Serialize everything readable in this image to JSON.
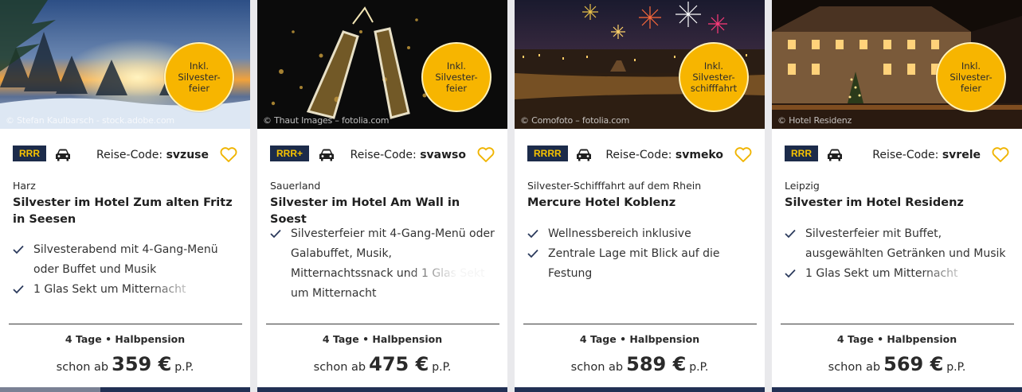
{
  "colors": {
    "navy": "#1c2b4a",
    "gold": "#f7b500",
    "heart": "#f0b400",
    "check": "#2b3a5c"
  },
  "cards": [
    {
      "credit": "© Stefan Kaulbarsch - stock.adobe.com",
      "badge": "Inkl.\nSilvester-\nfeier",
      "rating": "RRR",
      "code_label": "Reise-Code:",
      "code": "svzuse",
      "region": "Harz",
      "hotel": "Silvester im Hotel Zum alten Fritz in Seesen",
      "features": [
        "Silvesterabend mit 4-Gang-Menü oder Buffet und Musik",
        "1 Glas Sekt um Mitternacht"
      ],
      "duration": "4 Tage • Halbpension",
      "price_prefix": "schon ab",
      "price": "359 €",
      "price_suffix": "p.P.",
      "progress": 0.4
    },
    {
      "credit": "© Thaut Images – fotolia.com",
      "badge": "Inkl.\nSilvester-\nfeier",
      "rating": "RRR+",
      "code_label": "Reise-Code:",
      "code": "svawso",
      "region": "Sauerland",
      "hotel": "Silvester im Hotel Am Wall in Soest",
      "features": [
        "Silvesterfeier mit 4-Gang-Menü oder Galabuffet, Musik, Mitternachtssnack und 1 Glas Sekt um Mitternacht"
      ],
      "duration": "4 Tage • Halbpension",
      "price_prefix": "schon ab",
      "price": "475 €",
      "price_suffix": "p.P.",
      "progress": 0
    },
    {
      "credit": "© Comofoto – fotolia.com",
      "badge": "Inkl.\nSilvester-\nschifffahrt",
      "rating": "RRRR",
      "code_label": "Reise-Code:",
      "code": "svmeko",
      "region": "Silvester-Schifffahrt auf dem Rhein",
      "hotel": "Mercure Hotel Koblenz",
      "features": [
        "Wellnessbereich inklusive",
        "Zentrale Lage mit Blick auf die Festung"
      ],
      "duration": "4 Tage • Halbpension",
      "price_prefix": "schon ab",
      "price": "589 €",
      "price_suffix": "p.P.",
      "progress": 0
    },
    {
      "credit": "© Hotel Residenz",
      "badge": "Inkl.\nSilvester-\nfeier",
      "rating": "RRR",
      "code_label": "Reise-Code:",
      "code": "svrele",
      "region": "Leipzig",
      "hotel": "Silvester im Hotel Residenz",
      "features": [
        "Silvesterfeier mit Buffet, ausgewählten Getränken und Musik",
        "1 Glas Sekt um Mitternacht"
      ],
      "duration": "4 Tage • Halbpension",
      "price_prefix": "schon ab",
      "price": "569 €",
      "price_suffix": "p.P.",
      "progress": 0
    }
  ]
}
